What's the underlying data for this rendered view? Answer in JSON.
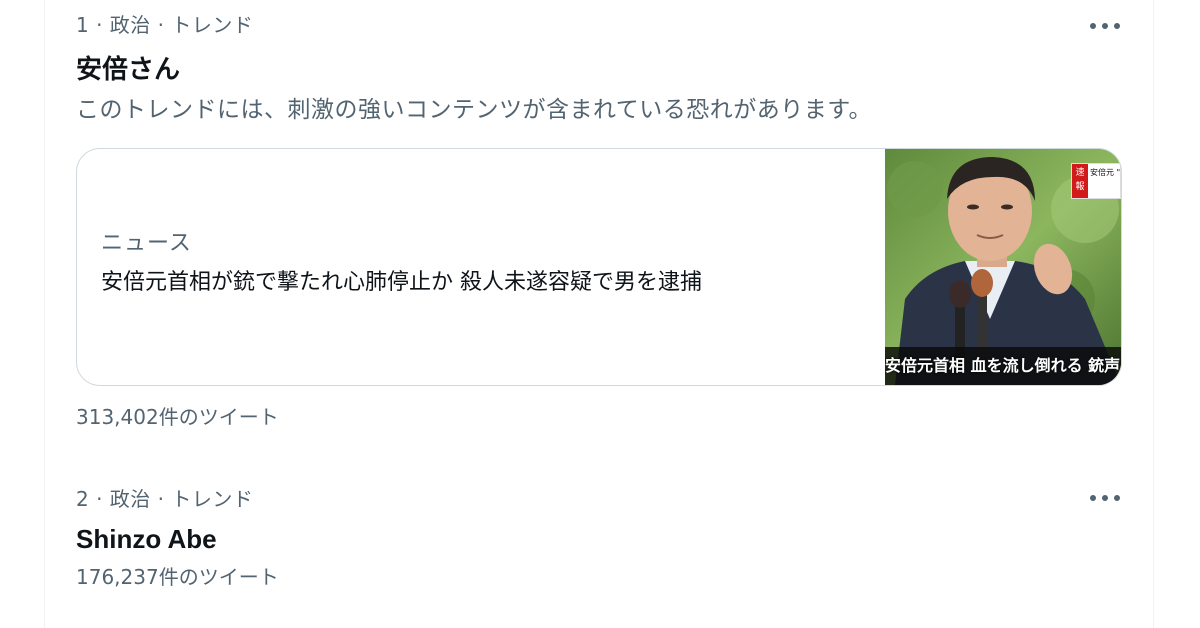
{
  "trends": [
    {
      "meta": "1 · 政治 · トレンド",
      "title": "安倍さん",
      "warning": "このトレンドには、刺激の強いコンテンツが含まれている恐れがあります。",
      "card": {
        "label": "ニュース",
        "headline": "安倍元首相が銃で撃たれ心肺停止か 殺人未遂容疑で男を逮捕",
        "thumbnail_caption": "安倍元首相 血を流し倒れる 銃声のよ",
        "thumbnail_badge_left": "速報",
        "thumbnail_badge_right": "安倍元 \"銃声の"
      },
      "count": "313,402件のツイート"
    },
    {
      "meta": "2 · 政治 · トレンド",
      "title": "Shinzo Abe",
      "count": "176,237件のツイート"
    }
  ],
  "icons": {
    "more": "more-horizontal-icon"
  },
  "colors": {
    "primary_text": "#0f1419",
    "secondary_text": "#536471",
    "border": "#cfd9de"
  }
}
